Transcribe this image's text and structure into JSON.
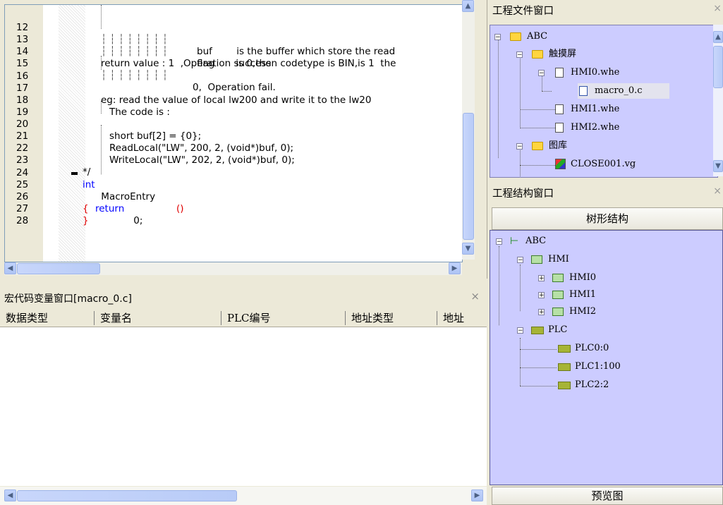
{
  "editor": {
    "lines": [
      {
        "n": "12",
        "pre": "",
        "text": "buf        is the buffer which store the read"
      },
      {
        "n": "13",
        "pre": "",
        "text": "flag       is 0,then codetype is BIN,is 1  the"
      },
      {
        "n": "14",
        "pre": "",
        "text": "return value : 1  ,Operation success"
      },
      {
        "n": "15",
        "pre": "",
        "text": "0,  Operation fail."
      },
      {
        "n": "16",
        "pre": "",
        "text": ""
      },
      {
        "n": "17",
        "pre": "",
        "text": "eg: read the value of local lw200 and write it to the lw20"
      },
      {
        "n": "18",
        "pre": "",
        "text": "The code is :"
      },
      {
        "n": "19",
        "pre": "",
        "text": ""
      },
      {
        "n": "20",
        "pre": "",
        "text": "short buf[2] = {0};"
      },
      {
        "n": "21",
        "pre": "",
        "text": "ReadLocal(\"LW\", 200, 2, (void*)buf, 0);"
      },
      {
        "n": "22",
        "pre": "",
        "text": "WriteLocal(\"LW\", 202, 2, (void*)buf, 0);"
      },
      {
        "n": "23",
        "pre": "",
        "text": "*/"
      },
      {
        "n": "24",
        "pre": "",
        "kw": "int",
        "text": " MacroEntry",
        "paren": "()"
      },
      {
        "n": "25",
        "pre": "",
        "paren": "{"
      },
      {
        "n": "26",
        "pre": "",
        "kw": "return",
        "text": " 0;"
      },
      {
        "n": "27",
        "pre": "",
        "paren": "}"
      },
      {
        "n": "28",
        "pre": "",
        "text": ""
      }
    ]
  },
  "var_window": {
    "title": "宏代码变量窗口[macro_0.c]",
    "close": "×",
    "columns": [
      "数据类型",
      "变量名",
      "PLC编号",
      "地址类型",
      "地址"
    ]
  },
  "file_window": {
    "title": "工程文件窗口",
    "close": "×",
    "nodes": {
      "abc": "ABC",
      "touch": "触摸屏",
      "hmi0": "HMI0.whe",
      "macro": "macro_0.c",
      "hmi1": "HMI1.whe",
      "hmi2": "HMI2.whe",
      "gallery": "图库",
      "close001": "CLOSE001.vg"
    }
  },
  "struct_window": {
    "title": "工程结构窗口",
    "close": "×",
    "tab_label": "树形结构",
    "nodes": {
      "abc": "ABC",
      "hmi": "HMI",
      "hmi0": "HMI0",
      "hmi1": "HMI1",
      "hmi2": "HMI2",
      "plc": "PLC",
      "plc0": "PLC0:0",
      "plc1": "PLC1:100",
      "plc2": "PLC2:2"
    }
  },
  "preview": {
    "label": "预览图"
  },
  "colors": {
    "tree_bg": "#ccccff",
    "keyword": "#0000ff",
    "brace": "#e00000"
  }
}
